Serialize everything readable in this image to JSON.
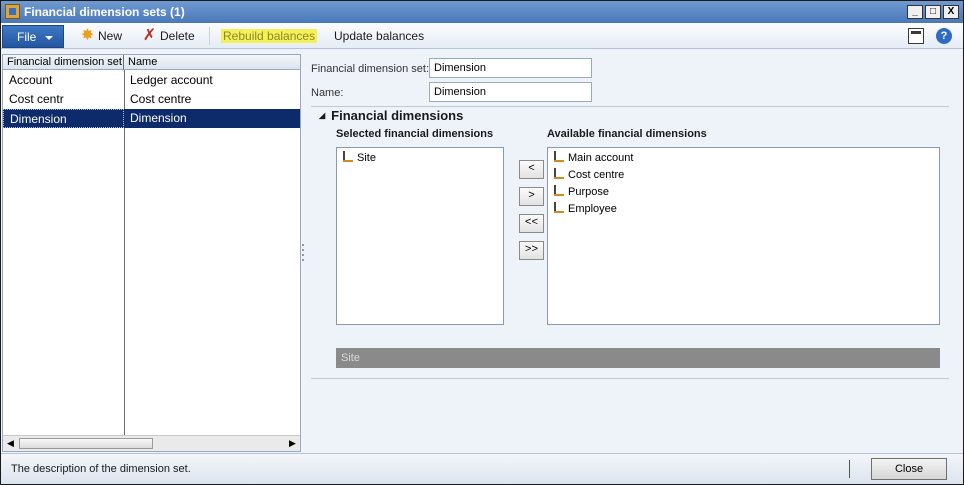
{
  "window": {
    "title": "Financial dimension sets (1)",
    "controls": [
      "_",
      "□",
      "X"
    ]
  },
  "actionbar": {
    "file_label": "File",
    "new_label": "New",
    "delete_label": "Delete",
    "rebuild_label": "Rebuild balances",
    "update_label": "Update balances",
    "help_label": "?"
  },
  "grid": {
    "headers": [
      "Financial dimension set",
      "Name"
    ],
    "rows": [
      {
        "set": "Account",
        "name": "Ledger account"
      },
      {
        "set": "Cost centr",
        "name": "Cost centre"
      },
      {
        "set": "Dimension",
        "name": "Dimension"
      }
    ],
    "selected_index": 2
  },
  "form": {
    "set_label": "Financial dimension set:",
    "set_value": "Dimension",
    "name_label": "Name:",
    "name_value": "Dimension"
  },
  "dimensions": {
    "group_title": "Financial dimensions",
    "selected_title": "Selected financial dimensions",
    "available_title": "Available financial dimensions",
    "selected": [
      "Site"
    ],
    "available": [
      "Main account",
      "Cost centre",
      "Purpose",
      "Employee"
    ],
    "buttons": [
      "<",
      ">",
      "<<",
      ">>"
    ],
    "status_value": "Site"
  },
  "statusbar": {
    "description": "The description of the dimension set.",
    "close_label": "Close"
  }
}
